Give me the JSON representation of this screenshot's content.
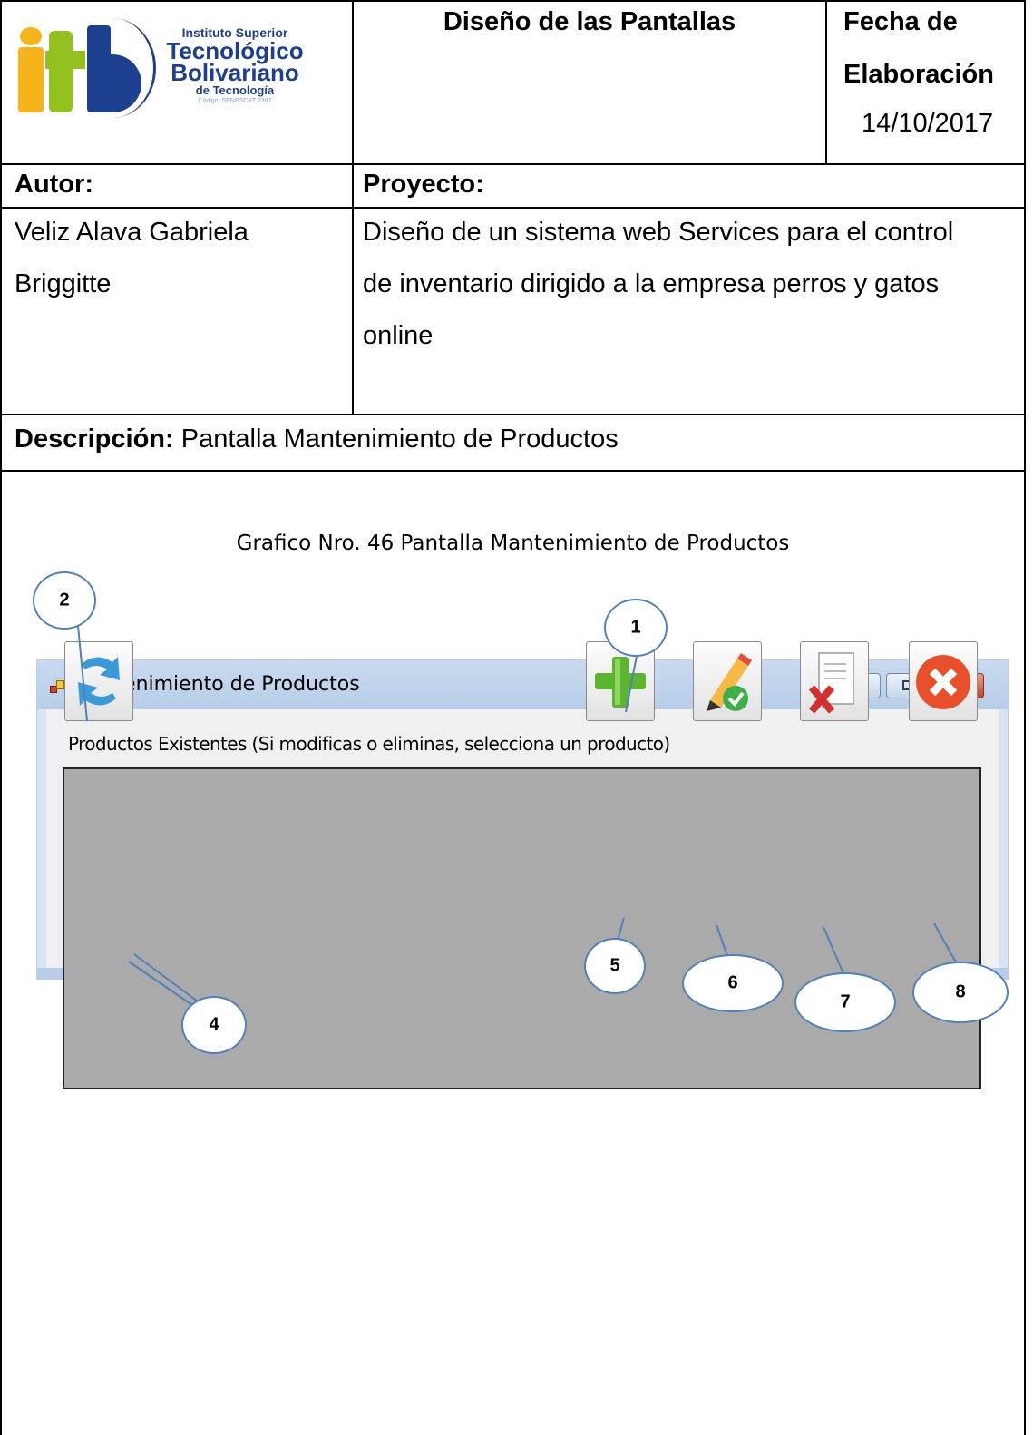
{
  "header": {
    "logo": {
      "line1": "Instituto Superior",
      "line2": "Tecnológico",
      "line3": "Bolivariano",
      "line4": "de Tecnología",
      "line5": "Código: SENESCYT 2397"
    },
    "title": "Diseño de las Pantallas",
    "date_label_line1": "Fecha de",
    "date_label_line2": "Elaboración",
    "date_value": "14/10/2017"
  },
  "info": {
    "author_label": "Autor:",
    "author_line1": "Veliz Alava Gabriela",
    "author_line2": "Briggitte",
    "project_label": "Proyecto:",
    "project_line1": "Diseño de un sistema web Services para el control",
    "project_line2": "de inventario dirigido a la empresa perros y gatos",
    "project_line3": "online",
    "description_label": "Descripción:",
    "description_value": " Pantalla Mantenimiento de Productos"
  },
  "figure": {
    "caption": "Grafico Nro. 46 Pantalla Mantenimiento de Productos",
    "window_title": "Mantenimiento de Productos",
    "grid_label": "Productos Existentes (Si modificas o eliminas, selecciona un producto)",
    "callouts": [
      "1",
      "2",
      "4",
      "5",
      "6",
      "7",
      "8"
    ],
    "icons": [
      "refresh-icon",
      "add-icon",
      "edit-icon",
      "delete-icon",
      "close-icon"
    ],
    "colors": {
      "title_bar": "#c9daee",
      "grid_background": "#aaaaaa",
      "callout_border": "#4f81bd"
    }
  }
}
